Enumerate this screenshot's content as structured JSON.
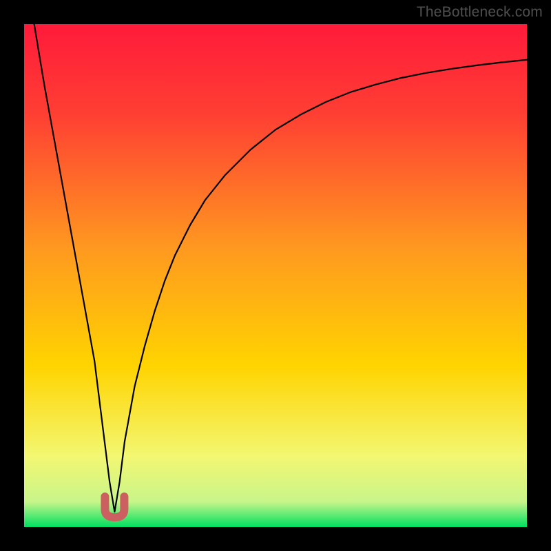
{
  "watermark": "TheBottleneck.com",
  "chart_data": {
    "type": "line",
    "title": "",
    "xlabel": "",
    "ylabel": "",
    "xlim": [
      0,
      100
    ],
    "ylim": [
      0,
      100
    ],
    "grid": false,
    "legend": false,
    "background_gradient": {
      "top_color": "#ff1a3a",
      "mid_color": "#ffd400",
      "bottom_color": "#00e060"
    },
    "marker": {
      "shape": "u",
      "color": "#cc5f5f",
      "x": 18,
      "y": 3
    },
    "series": [
      {
        "name": "curve",
        "color": "#000000",
        "x": [
          2,
          4,
          6,
          8,
          10,
          12,
          14,
          16,
          17,
          18,
          19,
          20,
          22,
          24,
          26,
          28,
          30,
          33,
          36,
          40,
          45,
          50,
          55,
          60,
          65,
          70,
          75,
          80,
          85,
          90,
          95,
          100
        ],
        "y": [
          100,
          88,
          77,
          66,
          55,
          44,
          33,
          17,
          9,
          3,
          9,
          17,
          28,
          36,
          43,
          49,
          54,
          60,
          65,
          70,
          75,
          79,
          82,
          84.5,
          86.5,
          88,
          89.3,
          90.3,
          91.1,
          91.8,
          92.4,
          92.9
        ]
      }
    ]
  }
}
